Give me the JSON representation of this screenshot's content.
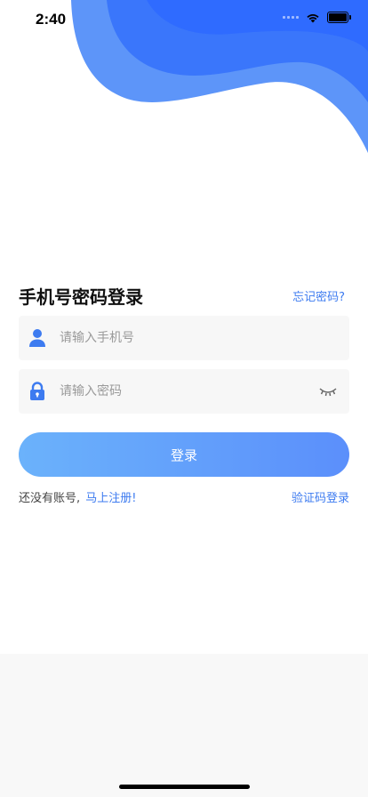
{
  "status_bar": {
    "time": "2:40"
  },
  "login": {
    "title": "手机号密码登录",
    "forgot_password": "忘记密码?",
    "phone_placeholder": "请输入手机号",
    "password_placeholder": "请输入密码",
    "login_button": "登录",
    "no_account_text": "还没有账号,",
    "register_link": "马上注册!",
    "sms_login_link": "验证码登录"
  },
  "colors": {
    "accent": "#3d7bf0",
    "wave_dark": "#2f6bff",
    "wave_light": "#5d95f9",
    "button_start": "#6bb2fb",
    "button_end": "#5b8ffb"
  },
  "icons": {
    "phone_field": "user-icon",
    "password_field": "lock-icon",
    "password_toggle": "eye-closed-icon"
  }
}
